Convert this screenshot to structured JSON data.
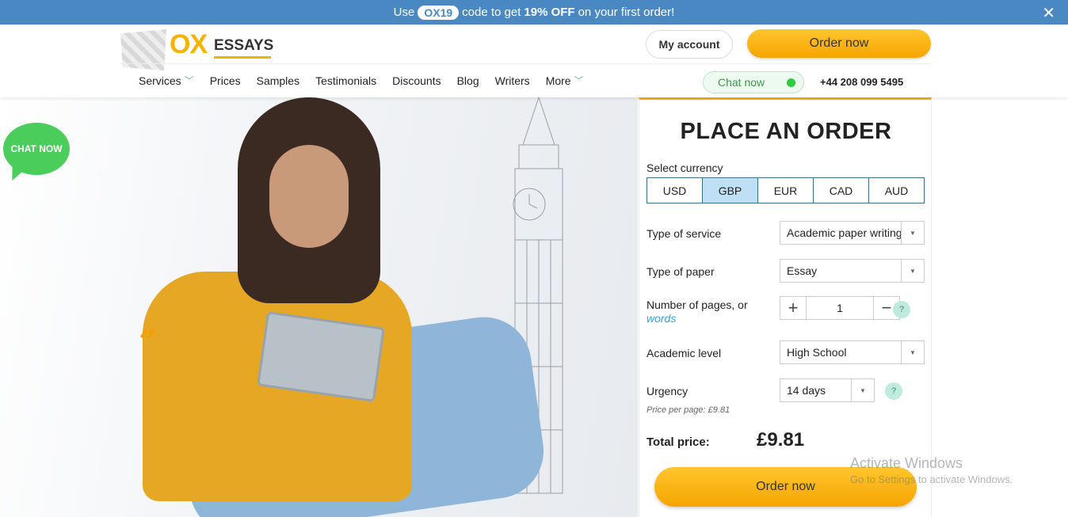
{
  "promo": {
    "prefix": "Use",
    "code": "OX19",
    "middle": "code to get",
    "discount": "19% OFF",
    "suffix": "on your first order!",
    "close": "✕"
  },
  "header": {
    "logo_ox": "OX",
    "logo_essays": "ESSAYS",
    "my_account": "My account",
    "order_now": "Order now",
    "chat_now": "Chat now",
    "phone": "+44 208 099 5495"
  },
  "nav": [
    {
      "label": "Services",
      "has_dropdown": true
    },
    {
      "label": "Prices"
    },
    {
      "label": "Samples"
    },
    {
      "label": "Testimonials"
    },
    {
      "label": "Discounts"
    },
    {
      "label": "Blog"
    },
    {
      "label": "Writers"
    },
    {
      "label": "More",
      "has_dropdown": true
    }
  ],
  "chat_bubble": {
    "label": "CHAT NOW",
    "color": "#4bcd5c"
  },
  "order": {
    "title": "PLACE AN ORDER",
    "currency_label": "Select currency",
    "currencies": [
      "USD",
      "GBP",
      "EUR",
      "CAD",
      "AUD"
    ],
    "selected_currency": "GBP",
    "service_label": "Type of service",
    "service_value": "Academic paper writing",
    "paper_label": "Type of paper",
    "paper_value": "Essay",
    "pages_label": "Number of pages, or",
    "pages_link": "words",
    "pages_value": "1",
    "level_label": "Academic level",
    "level_value": "High School",
    "urgency_label": "Urgency",
    "urgency_value": "14 days",
    "price_per_page": "Price per page:  £9.81",
    "total_label": "Total price:",
    "total_value": "£9.81",
    "order_button": "Order now",
    "help": "?"
  },
  "watermark": {
    "line1": "Activate Windows",
    "line2": "Go to Settings to activate Windows."
  },
  "colors": {
    "accent": "#f5b300",
    "promo_bg": "#4a88c4",
    "selected_currency_bg": "#bfe0f4",
    "link": "#3aa1d6"
  }
}
